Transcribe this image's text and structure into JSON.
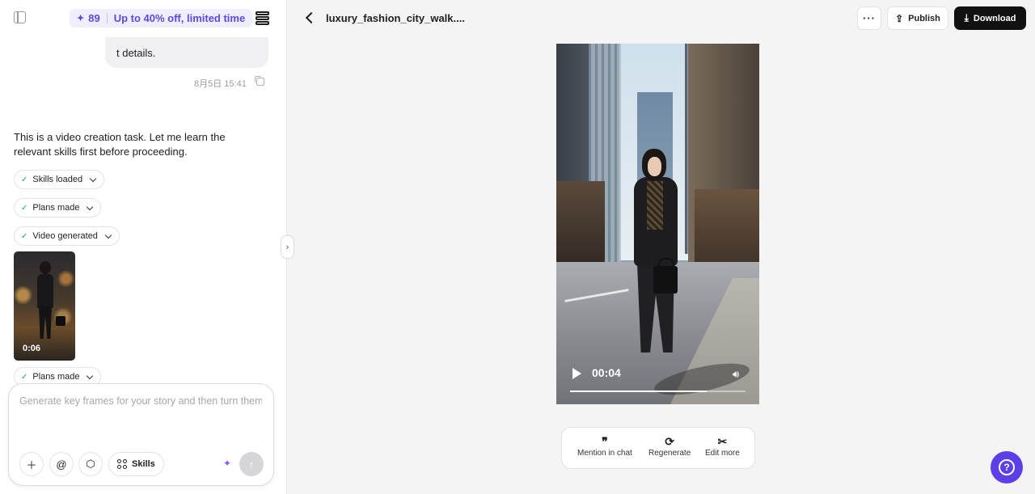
{
  "promo": {
    "credits": "89",
    "offer": "Up to 40% off, limited time"
  },
  "chat": {
    "user_message_tail": "t details.",
    "user_message_time": "8月5日 15:41",
    "assistant_text": "This is a video creation task. Let me learn the relevant skills first before proceeding.",
    "steps": [
      {
        "label": "Skills loaded"
      },
      {
        "label": "Plans made"
      },
      {
        "label": "Video generated"
      },
      {
        "label": "Plans made"
      }
    ],
    "video_thumb": {
      "duration": "0:06"
    }
  },
  "composer": {
    "placeholder": "Generate key frames for your story and then turn them",
    "skills_label": "Skills"
  },
  "viewer": {
    "file_title": "luxury_fashion_city_walk....",
    "more_label": "···",
    "publish_label": "Publish",
    "download_label": "Download",
    "current_time": "00:04",
    "progress": 0.78
  },
  "actions": {
    "mention": "Mention in chat",
    "regenerate": "Regenerate",
    "edit_more": "Edit more"
  },
  "icons": {
    "sidebar_toggle": "sidebar-toggle-icon",
    "menu": "stack-icon",
    "plus": "plus-icon",
    "at": "at-icon",
    "cube": "cube-icon",
    "skills": "grid-icon",
    "sparkle": "sparkle-icon",
    "send": "arrow-up-icon",
    "help": "question-icon"
  },
  "colors": {
    "accent": "#5e3ee6",
    "promo_text": "#5b49e0",
    "download_bg": "#111111"
  }
}
